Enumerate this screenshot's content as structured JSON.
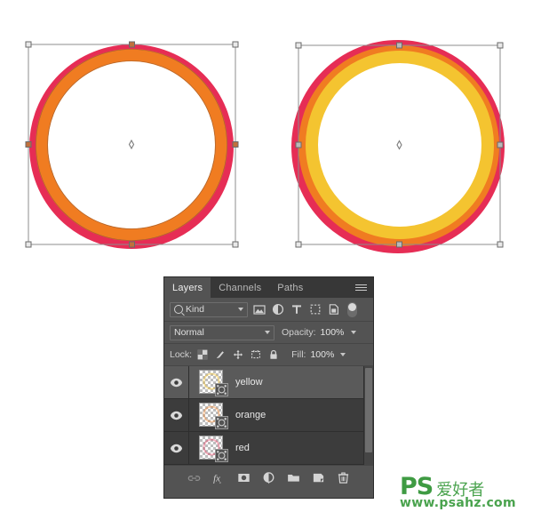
{
  "app": {
    "name": "Adobe Photoshop Layers Panel",
    "background_color": "#ffffff"
  },
  "canvas": {
    "artworks": [
      {
        "id": "left-artwork",
        "name": "two-ring-circle",
        "description": "Circle with red outer ring and orange ring, transform box active",
        "rings": [
          {
            "name": "red",
            "color": "#E62D55",
            "radius": 107,
            "stroke": 13
          },
          {
            "name": "orange",
            "color": "#F07C21",
            "radius": 100,
            "stroke": 13
          }
        ],
        "selection": {
          "visible": true,
          "handles": 8,
          "center_marker": true
        }
      },
      {
        "id": "right-artwork",
        "name": "three-ring-circle",
        "description": "Circle with red, orange and yellow rings, transform box active",
        "rings": [
          {
            "name": "red",
            "color": "#E62D55",
            "radius": 112,
            "stroke": 13
          },
          {
            "name": "orange",
            "color": "#F07C21",
            "radius": 105,
            "stroke": 13
          },
          {
            "name": "yellow",
            "color": "#F4C430",
            "radius": 98,
            "stroke": 13
          }
        ],
        "selection": {
          "visible": true,
          "handles": 8,
          "center_marker": true
        }
      }
    ]
  },
  "panel": {
    "tabs": [
      {
        "label": "Layers",
        "active": true
      },
      {
        "label": "Channels",
        "active": false
      },
      {
        "label": "Paths",
        "active": false
      }
    ],
    "menu_icon": "hamburger-menu-icon",
    "filter": {
      "kind_label": "Kind",
      "search_icon": "search-icon",
      "type_filters": [
        {
          "name": "pixel-layer-filter-icon",
          "title": "Pixel layers"
        },
        {
          "name": "adjustment-layer-filter-icon",
          "title": "Adjustment layers"
        },
        {
          "name": "type-layer-filter-icon",
          "title": "Type layers"
        },
        {
          "name": "shape-layer-filter-icon",
          "title": "Shape layers"
        },
        {
          "name": "smart-object-filter-icon",
          "title": "Smart objects"
        }
      ],
      "toggle_icon": "filter-toggle-switch"
    },
    "blend": {
      "mode": "Normal",
      "opacity_label": "Opacity:",
      "opacity_value": "100%"
    },
    "lock": {
      "label": "Lock:",
      "icons": [
        {
          "name": "lock-transparent-pixels-icon"
        },
        {
          "name": "lock-image-pixels-icon"
        },
        {
          "name": "lock-position-icon"
        },
        {
          "name": "lock-artboard-nesting-icon"
        },
        {
          "name": "lock-all-icon"
        }
      ],
      "fill_label": "Fill:",
      "fill_value": "100%"
    },
    "layers": [
      {
        "name": "yellow",
        "visible": true,
        "selected": true,
        "thumb": "checkerboard-ring-thumbnail",
        "has_vector_mask": true
      },
      {
        "name": "orange",
        "visible": true,
        "selected": false,
        "thumb": "checkerboard-ring-thumbnail",
        "has_vector_mask": true
      },
      {
        "name": "red",
        "visible": true,
        "selected": false,
        "thumb": "checkerboard-ring-thumbnail",
        "has_vector_mask": true
      }
    ],
    "bottom_buttons": [
      {
        "name": "link-layers-icon"
      },
      {
        "name": "layer-style-fx-icon"
      },
      {
        "name": "add-layer-mask-icon"
      },
      {
        "name": "new-adjustment-layer-icon"
      },
      {
        "name": "new-group-icon"
      },
      {
        "name": "new-layer-icon"
      },
      {
        "name": "delete-layer-icon"
      }
    ],
    "colors": {
      "panel_bg": "#535353",
      "list_bg": "#3c3c3c",
      "selected_row": "#5a5a5a",
      "tabbar_bg": "#373737",
      "text": "#d6d6d6"
    }
  },
  "watermark": {
    "ps": "PS",
    "chinese": "爱好者",
    "url": "www.psahz.com",
    "color": "#4aa34e"
  }
}
